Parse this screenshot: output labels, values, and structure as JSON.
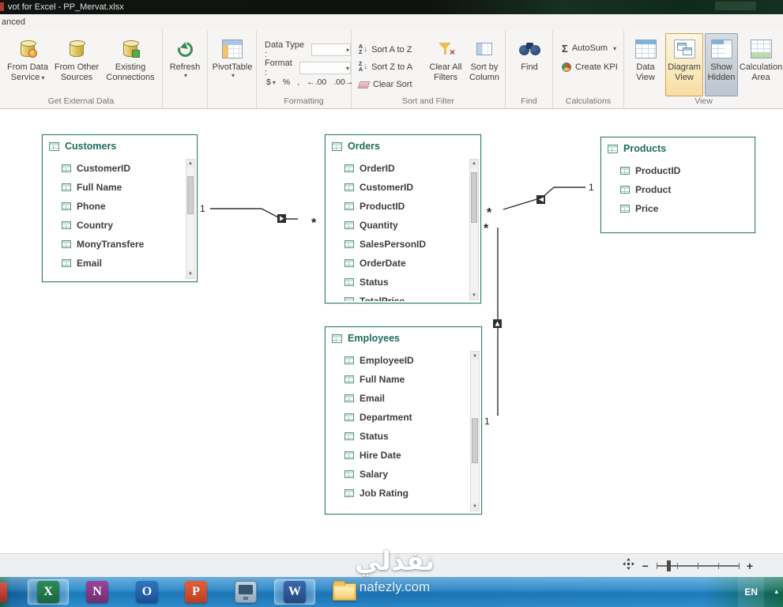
{
  "titlebar": {
    "title": "vot for Excel - PP_Mervat.xlsx"
  },
  "tab_row": {
    "active_tab": "anced"
  },
  "ribbon": {
    "external": {
      "label": "Get External Data",
      "from_data_service": "From Data Service",
      "from_other_sources": "From Other Sources",
      "existing_connections": "Existing Connections"
    },
    "refresh": {
      "button": "Refresh"
    },
    "pivottable": {
      "button": "PivotTable"
    },
    "formatting": {
      "label": "Formatting",
      "data_type": "Data Type :",
      "format": "Format :",
      "currency": "$",
      "percent": "%",
      "comma": ",",
      "decrease_decimal": "←.00",
      "increase_decimal": ".00→"
    },
    "sort_filter": {
      "label": "Sort and Filter",
      "sort_az": "Sort A to Z",
      "sort_za": "Sort Z to A",
      "clear_sort": "Clear Sort",
      "clear_all_filters": "Clear All Filters",
      "sort_by_column": "Sort by Column"
    },
    "find": {
      "label": "Find",
      "button": "Find"
    },
    "calculations": {
      "label": "Calculations",
      "autosum": "AutoSum",
      "create_kpi": "Create KPI"
    },
    "view": {
      "label": "View",
      "data_view": "Data View",
      "diagram_view": "Diagram View",
      "show_hidden": "Show Hidden",
      "calculation_area": "Calculation Area"
    }
  },
  "diagram": {
    "tables": [
      {
        "name": "Customers",
        "fields": [
          "CustomerID",
          "Full Name",
          "Phone",
          "Country",
          "MonyTransfere",
          "Email"
        ]
      },
      {
        "name": "Orders",
        "fields": [
          "OrderID",
          "CustomerID",
          "ProductID",
          "Quantity",
          "SalesPersonID",
          "OrderDate",
          "Status",
          "TotalPrice"
        ]
      },
      {
        "name": "Products",
        "fields": [
          "ProductID",
          "Product",
          "Price"
        ]
      },
      {
        "name": "Employees",
        "fields": [
          "EmployeeID",
          "Full Name",
          "Email",
          "Department",
          "Status",
          "Hire Date",
          "Salary",
          "Job Rating"
        ]
      }
    ],
    "relationships": [
      {
        "from": "Customers",
        "to": "Orders",
        "one": "1",
        "many": "*"
      },
      {
        "from": "Products",
        "to": "Orders",
        "one": "1",
        "many": "*"
      },
      {
        "from": "Employees",
        "to": "Orders",
        "one": "1",
        "many": "*"
      }
    ]
  },
  "statusbar": {
    "zoom_out": "−",
    "zoom_in": "+"
  },
  "taskbar": {
    "language": "EN",
    "watermark": {
      "arabic": "نفذلي",
      "latin": "nafezly.com"
    },
    "apps": {
      "excel": "X",
      "onenote": "N",
      "outlook": "O",
      "powerpoint": "P",
      "word": "W"
    }
  },
  "colors": {
    "accent_teal": "#2f7e6a",
    "selected_orange": "#f7dfa3",
    "taskbar_blue": "#2288cc",
    "title_dark": "#101412"
  }
}
